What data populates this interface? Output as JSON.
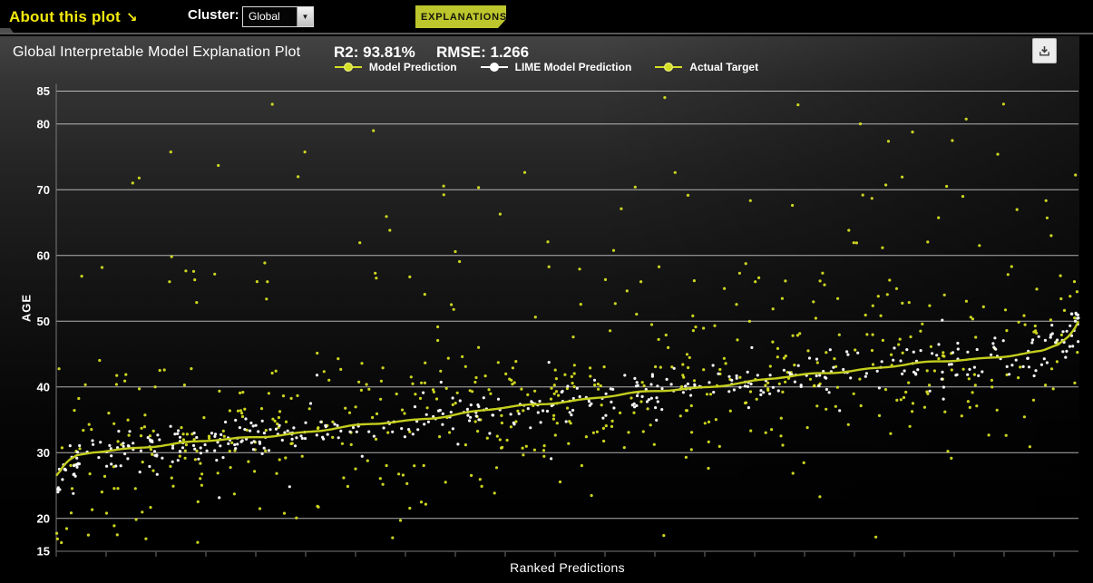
{
  "top_bar": {
    "about_label": "About this plot",
    "about_arrow": "↘",
    "cluster_label": "Cluster:",
    "cluster_value": "Global",
    "explanations_button": "EXPLANATIONS"
  },
  "panel": {
    "title": "Global Interpretable Model Explanation Plot",
    "r2_text": "R2: 93.81%",
    "rmse_text": "RMSE: 1.266"
  },
  "chart_data": {
    "type": "scatter",
    "title": "Global Interpretable Model Explanation Plot",
    "stats": {
      "r2_percent": 93.81,
      "rmse": 1.266
    },
    "xlabel": "Ranked Predictions",
    "ylabel": "AGE",
    "ylim": [
      15,
      85
    ],
    "yticks": [
      15,
      20,
      30,
      40,
      50,
      60,
      70,
      80,
      85
    ],
    "x_tick_count": 21,
    "x_tick_spacing_px": 55,
    "grid": "horizontal",
    "legend_position": "top-center",
    "legend": [
      {
        "label": "Model Prediction",
        "color": "#d7df21"
      },
      {
        "label": "LIME Model Prediction",
        "color": "#ffffff"
      },
      {
        "label": "Actual Target",
        "color": "#d7df21"
      }
    ],
    "series": {
      "model_prediction_line": {
        "name": "Model Prediction",
        "color": "#c4ce1d",
        "points_frac_value": [
          [
            0.0,
            26.4
          ],
          [
            0.003,
            26.9
          ],
          [
            0.007,
            27.8
          ],
          [
            0.012,
            28.6
          ],
          [
            0.02,
            29.4
          ],
          [
            0.035,
            30.0
          ],
          [
            0.06,
            30.5
          ],
          [
            0.09,
            31.0
          ],
          [
            0.12,
            31.4
          ],
          [
            0.17,
            32.0
          ],
          [
            0.22,
            32.8
          ],
          [
            0.26,
            33.4
          ],
          [
            0.32,
            34.5
          ],
          [
            0.38,
            35.6
          ],
          [
            0.44,
            36.8
          ],
          [
            0.5,
            37.9
          ],
          [
            0.56,
            38.9
          ],
          [
            0.62,
            39.8
          ],
          [
            0.68,
            40.8
          ],
          [
            0.743,
            42.0
          ],
          [
            0.8,
            42.9
          ],
          [
            0.85,
            43.6
          ],
          [
            0.9,
            44.3
          ],
          [
            0.94,
            45.0
          ],
          [
            0.965,
            45.4
          ],
          [
            0.98,
            46.4
          ],
          [
            0.99,
            47.6
          ],
          [
            0.996,
            48.7
          ],
          [
            1.0,
            49.9
          ]
        ]
      },
      "lime_scatter": {
        "name": "LIME Model Prediction",
        "color": "#ffffff",
        "count": 440,
        "sigma_around_line": 1.35,
        "outlier_rate": 0.1,
        "outlier_scale": 2.4,
        "left_tail_count": 16,
        "right_cluster_count": 14
      },
      "actual_scatter": {
        "name": "Actual Target",
        "color": "#d7df21",
        "band_count": 540,
        "band_sigma": 6.5,
        "band_max": 56,
        "high_count": 85,
        "high_range": [
          56,
          84.5
        ],
        "value_floor": 16.3
      }
    },
    "seed": 1337
  },
  "colors": {
    "grid": "#cfcfcf",
    "axis": "#7a7a7a",
    "x_tick": "#4a4a4a",
    "tick_label": "#ffffff",
    "accent_yellow": "#f2e90d",
    "button_green": "#bdc62c"
  },
  "icons": {
    "download": "download-icon",
    "select_arrow": "▼"
  }
}
